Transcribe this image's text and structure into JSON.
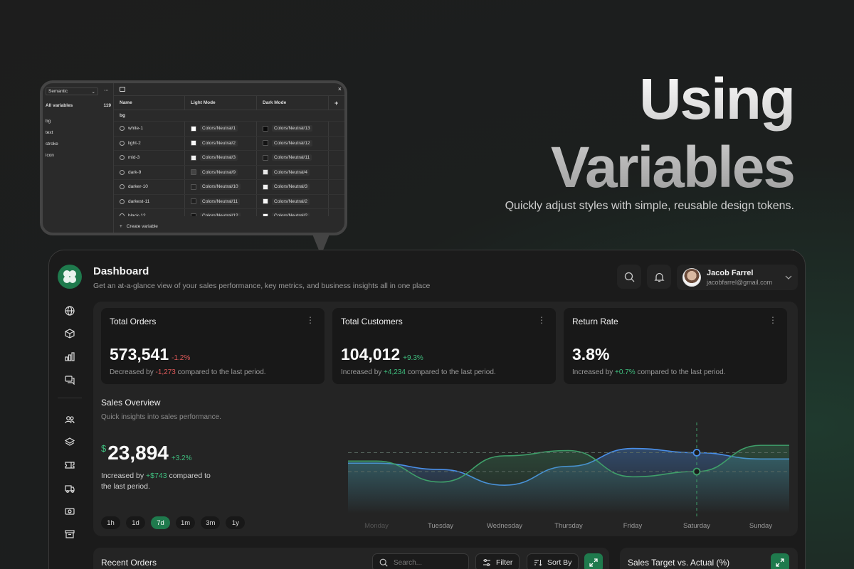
{
  "hero": {
    "title_line1": "Using",
    "title_line2": "Variables",
    "subtitle": "Quickly adjust styles with simple, reusable design tokens."
  },
  "variables_panel": {
    "collection_select": "Semantic",
    "all_variables_label": "All variables",
    "all_variables_count": "119",
    "groups": [
      "bg",
      "text",
      "stroke",
      "icon"
    ],
    "columns": [
      "Name",
      "Light Mode",
      "Dark Mode"
    ],
    "add_column_label": "+",
    "close_label": "×",
    "group_heading": "bg",
    "rows": [
      {
        "name": "white-1",
        "light": "Colors/Neutral/1",
        "dark": "Colors/Neutral/13",
        "light_color": "#ffffff",
        "dark_color": "#0a0a0a"
      },
      {
        "name": "light-2",
        "light": "Colors/Neutral/2",
        "dark": "Colors/Neutral/12",
        "light_color": "#f7f7f7",
        "dark_color": "#141414"
      },
      {
        "name": "mid-3",
        "light": "Colors/Neutral/3",
        "dark": "Colors/Neutral/11",
        "light_color": "#f0f0f0",
        "dark_color": "#1c1c1c"
      },
      {
        "name": "dark-9",
        "light": "Colors/Neutral/9",
        "dark": "Colors/Neutral/4",
        "light_color": "#434343",
        "dark_color": "#e8e8e8"
      },
      {
        "name": "darker-10",
        "light": "Colors/Neutral/10",
        "dark": "Colors/Neutral/3",
        "light_color": "#262626",
        "dark_color": "#f0f0f0"
      },
      {
        "name": "darkest-11",
        "light": "Colors/Neutral/11",
        "dark": "Colors/Neutral/2",
        "light_color": "#1f1f1f",
        "dark_color": "#f7f7f7"
      },
      {
        "name": "black-12",
        "light": "Colors/Neutral/12",
        "dark": "Colors/Neutral/2",
        "light_color": "#141414",
        "dark_color": "#fafafa"
      }
    ],
    "create_label": "Create variable"
  },
  "dashboard": {
    "title": "Dashboard",
    "subtitle": "Get an at-a-glance view of your sales performance, key metrics, and business insights all in one place",
    "user": {
      "name": "Jacob Farrel",
      "email": "jacobfarrel@gmail.com"
    },
    "nav_icons": [
      "globe-icon",
      "box-icon",
      "chart-icon",
      "chat-icon",
      "users-icon",
      "layers-icon",
      "ticket-icon",
      "truck-icon",
      "money-icon",
      "archive-icon"
    ],
    "cards": [
      {
        "title": "Total Orders",
        "value": "573,541",
        "delta": "-1.2%",
        "note_prefix": "Decreased by ",
        "note_value": "-1,273",
        "note_suffix": " compared to the last period.",
        "trend": "down"
      },
      {
        "title": "Total Customers",
        "value": "104,012",
        "delta": "+9.3%",
        "note_prefix": "Increased by ",
        "note_value": "+4,234",
        "note_suffix": " compared to the last period.",
        "trend": "up"
      },
      {
        "title": "Return Rate",
        "value": "3.8%",
        "delta": "",
        "note_prefix": "Increased by ",
        "note_value": "+0.7%",
        "note_suffix": " compared to the last period.",
        "trend": "up"
      }
    ],
    "sales_overview": {
      "title": "Sales Overview",
      "subtitle": "Quick insights into sales performance.",
      "currency": "$",
      "value": "23,894",
      "delta": "+3.2%",
      "note_prefix": "Increased by ",
      "note_value": "+$743",
      "note_suffix": " compared to the last period.",
      "ranges": [
        "1h",
        "1d",
        "7d",
        "1m",
        "3m",
        "1y"
      ],
      "active_range": "7d"
    },
    "recent_orders": {
      "title": "Recent Orders",
      "search_placeholder": "Search...",
      "filter_label": "Filter",
      "sort_label": "Sort By"
    },
    "sales_target": {
      "title": "Sales Target vs. Actual (%)"
    }
  },
  "colors": {
    "accent": "#1f7a4d",
    "positive": "#3fbf7f",
    "negative": "#e05a5a",
    "series_blue": "#4a8fe8",
    "series_green": "#3f9f6a"
  },
  "chart_data": {
    "type": "line",
    "categories": [
      "Monday",
      "Tuesday",
      "Wednesday",
      "Thursday",
      "Friday",
      "Saturday",
      "Sunday"
    ],
    "series": [
      {
        "values": [
          48,
          42,
          27,
          45,
          62,
          58,
          52
        ]
      },
      {
        "values": [
          50,
          30,
          55,
          60,
          35,
          40,
          65
        ]
      }
    ],
    "highlighted": "Saturday",
    "ylim": [
      0,
      80
    ],
    "grid": false
  }
}
